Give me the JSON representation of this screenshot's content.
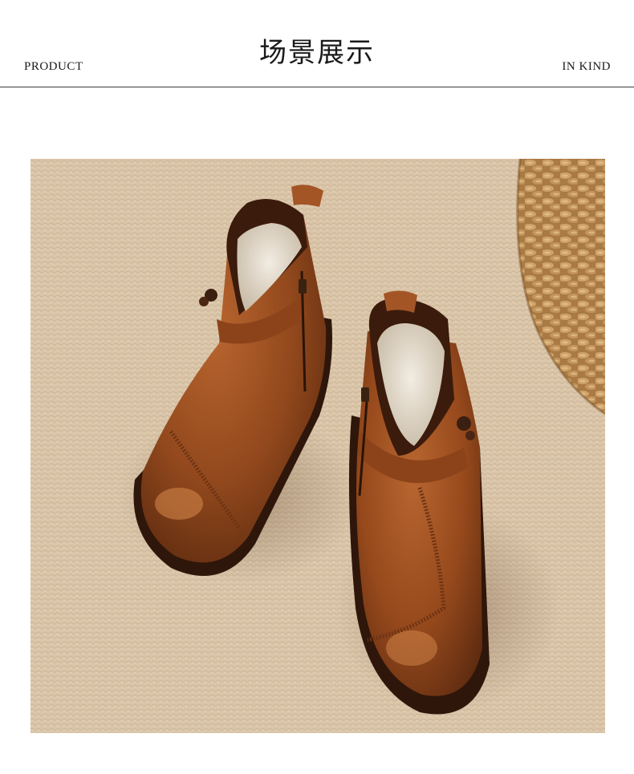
{
  "header": {
    "title": "场景展示",
    "left_label": "PRODUCT",
    "right_label": "IN KIND"
  },
  "photo": {
    "subject": "pair of brown leather ankle boots with zipper on woven carpet",
    "colors": {
      "carpet": "#d7c2a6",
      "leather": "#9a4f22",
      "leather_dark": "#5a2a10",
      "fur_lining": "#e9e1d4",
      "basket": "#b98a50"
    }
  }
}
